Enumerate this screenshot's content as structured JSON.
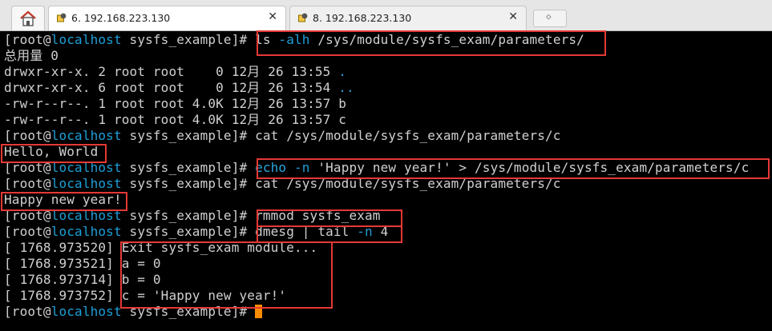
{
  "tabs": [
    {
      "label": "6. 192.168.223.130",
      "close": "✕",
      "active": true
    },
    {
      "label": "8. 192.168.223.130",
      "close": "✕",
      "active": false
    }
  ],
  "terminal": {
    "prompt_user": "[root@",
    "prompt_host": "localhost",
    "prompt_dir": " sysfs_example]# ",
    "lines": {
      "l0_cmd_a": "ls ",
      "l0_flag": "-alh",
      "l0_cmd_b": " /sys/module/sysfs_exam/parameters/",
      "l1": "总用量 0",
      "l2_a": "drwxr-xr-x. 2 root root    0 12月 26 13:55 ",
      "l2_dir": ".",
      "l3_a": "drwxr-xr-x. 6 root root    0 12月 26 13:54 ",
      "l3_dir": "..",
      "l4": "-rw-r--r--. 1 root root 4.0K 12月 26 13:57 b",
      "l5": "-rw-r--r--. 1 root root 4.0K 12月 26 13:57 c",
      "l6_cmd": "cat /sys/module/sysfs_exam/parameters/c",
      "l7": "Hello, World",
      "l8_echo": "echo",
      "l8_flag": " -n",
      "l8_rest": " 'Happy new year!' > /sys/module/sysfs_exam/parameters/c",
      "l9_cmd": "cat /sys/module/sysfs_exam/parameters/c",
      "l10": "Happy new year!",
      "l11_cmd": "rmmod sysfs_exam",
      "l12_cmd_a": "dmesg | tail ",
      "l12_flag": "-n",
      "l12_cmd_b": " 4",
      "l13": "[ 1768.973520] Exit sysfs_exam module...",
      "l14": "[ 1768.973521] a = 0",
      "l15": "[ 1768.973714] b = 0",
      "l16": "[ 1768.973752] c = 'Happy new year!'"
    }
  },
  "colors": {
    "highlight": "#e53935",
    "host": "#1e9fd9",
    "cursor": "#ff8c00"
  }
}
